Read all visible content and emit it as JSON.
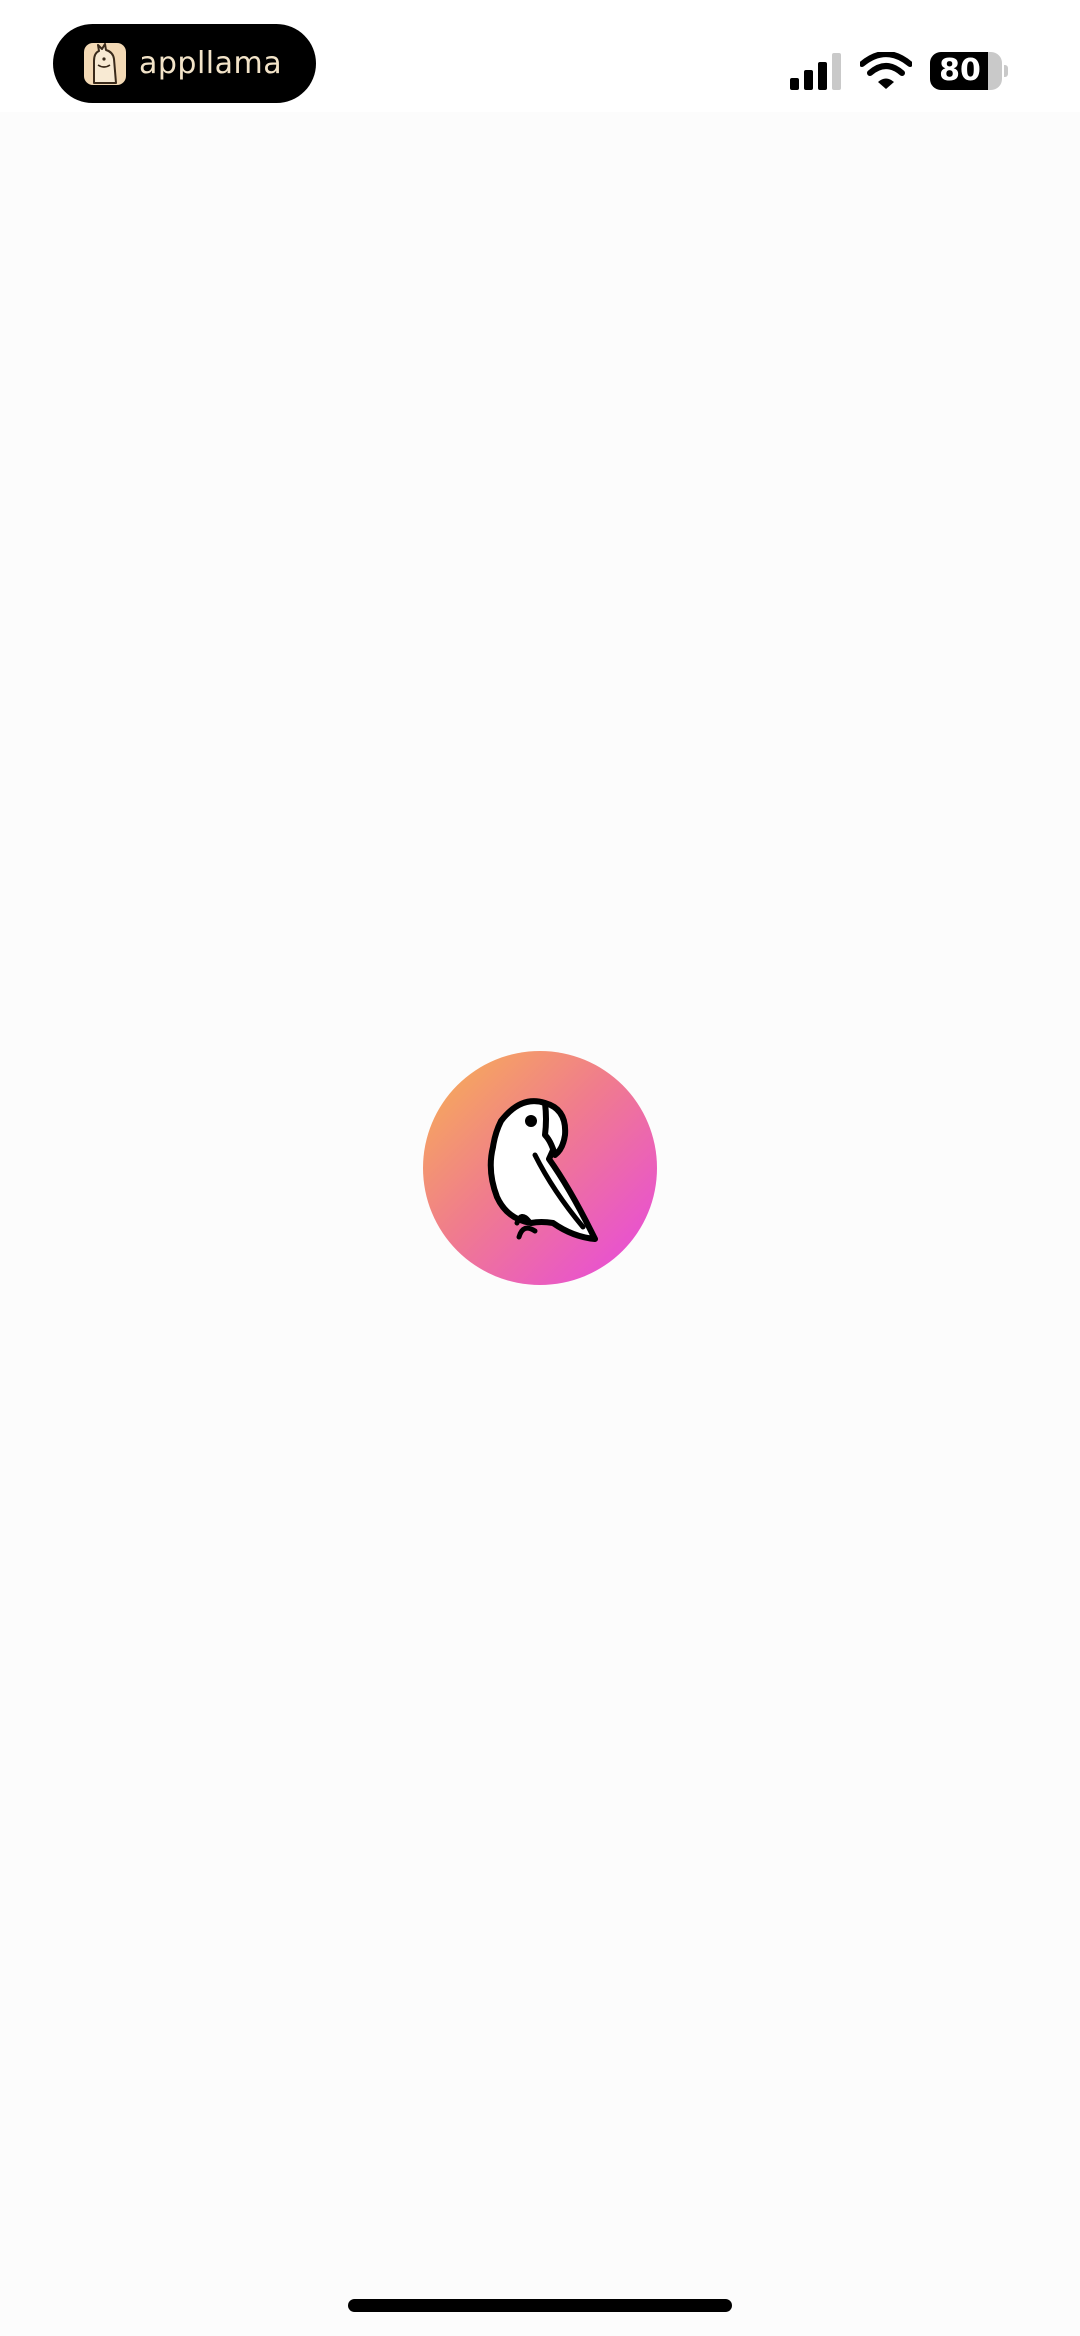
{
  "status_bar": {
    "app_name": "appllama",
    "battery_level": "80",
    "battery_fraction": 0.8,
    "signal_bars_active": 3,
    "signal_bars_total": 4,
    "icons": {
      "app": "llama-icon",
      "signal": "cellular-signal-icon",
      "wifi": "wifi-icon",
      "battery": "battery-icon"
    }
  },
  "splash": {
    "logo_icon": "parrot-logo-icon",
    "gradient_colors": [
      "#f7b350",
      "#f07c8d",
      "#e646e3"
    ]
  },
  "colors": {
    "background": "#fcfcfc",
    "pill_background": "#000000",
    "pill_text": "#f2e3c8"
  }
}
